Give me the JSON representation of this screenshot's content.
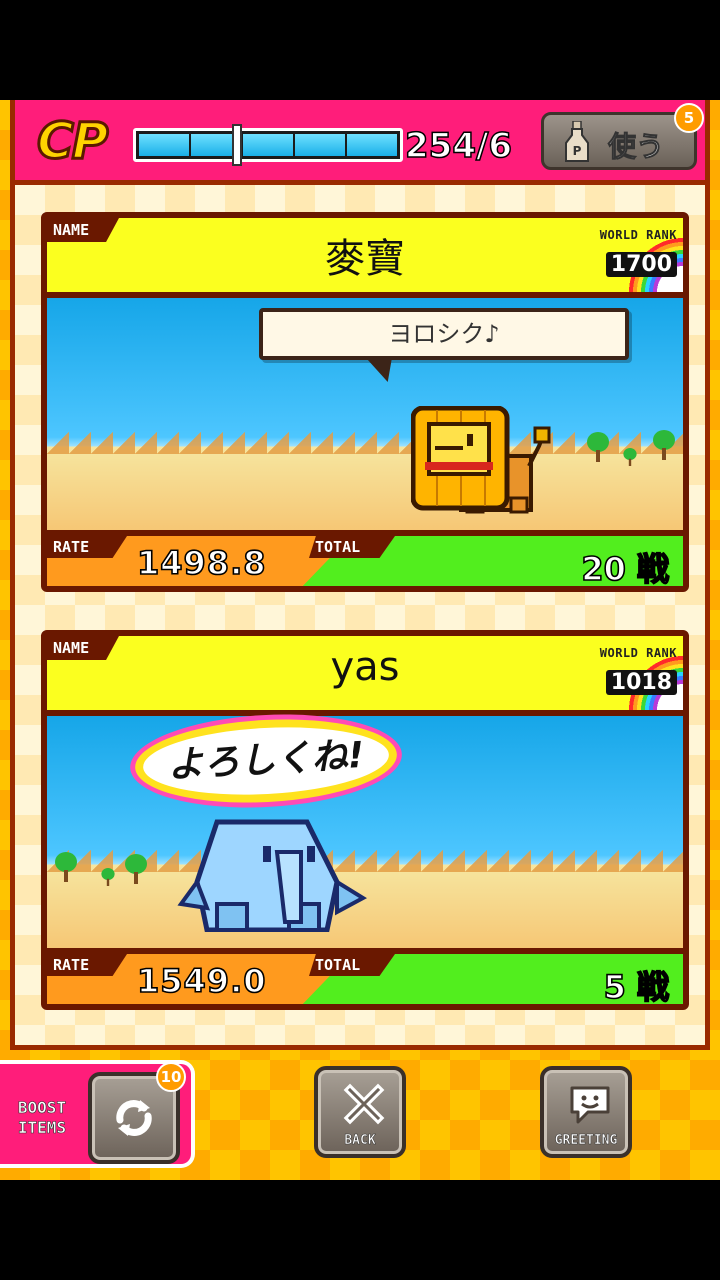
{
  "header": {
    "cp_logo": "CP",
    "cp_value": "254/6",
    "cp_fill_fraction": 0.38,
    "use_button": {
      "label": "使う",
      "badge": "5",
      "icon": "bottle-icon"
    }
  },
  "players": [
    {
      "name_label": "NAME",
      "name": "麥寶",
      "world_rank_label": "WORLD RANK",
      "world_rank": "1700",
      "greeting": "ヨロシク♪",
      "character": "lion",
      "rate_label": "RATE",
      "rate": "1498.8",
      "total_label": "TOTAL",
      "total": "20 戦"
    },
    {
      "name_label": "NAME",
      "name": "yas",
      "world_rank_label": "WORLD RANK",
      "world_rank": "1018",
      "greeting": "よろしくね!",
      "character": "elephant",
      "rate_label": "RATE",
      "rate": "1549.0",
      "total_label": "TOTAL",
      "total": "5 戦"
    }
  ],
  "footer": {
    "boost_label_line1": "BOOST",
    "boost_label_line2": "ITEMS",
    "boost_badge": "10",
    "boost_icon": "refresh-icon",
    "back_label": "BACK",
    "back_icon": "close-icon",
    "greeting_label": "GREETING",
    "greeting_icon": "speech-bubble-icon"
  },
  "colors": {
    "header_pink": "#ff1d7a",
    "name_yellow": "#fbff1f",
    "rate_orange": "#ff9a1e",
    "total_green": "#52ee1e",
    "frame_brown": "#6a1800"
  }
}
